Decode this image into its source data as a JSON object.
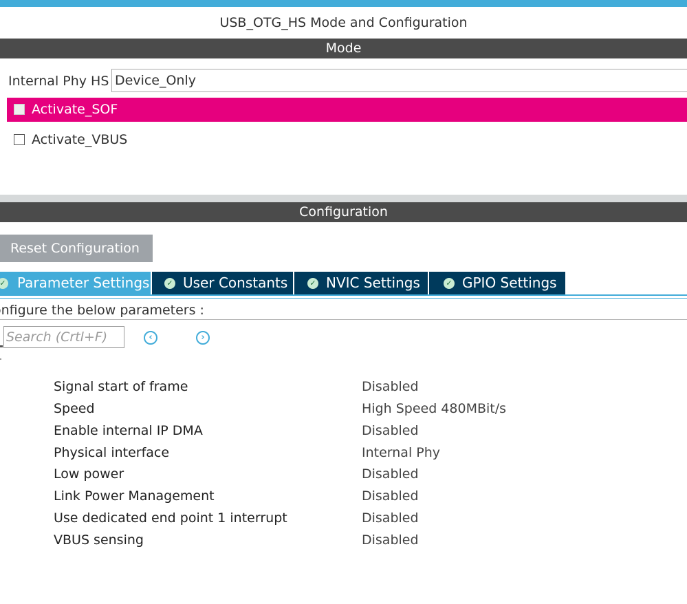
{
  "window": {
    "title": "USB_OTG_HS Mode and Configuration"
  },
  "mode": {
    "header": "Mode",
    "phy": {
      "label": "Internal Phy HS",
      "value": "Device_Only"
    },
    "checkboxes": [
      {
        "label": "Activate_SOF",
        "checked": false,
        "selected": true
      },
      {
        "label": "Activate_VBUS",
        "checked": false,
        "selected": false
      }
    ]
  },
  "configuration": {
    "header": "Configuration",
    "reset_label": "Reset Configuration",
    "tabs": [
      {
        "label": "Parameter Settings",
        "active": true,
        "icon": "check-circle-icon"
      },
      {
        "label": "User Constants",
        "active": false,
        "icon": "check-circle-icon"
      },
      {
        "label": "NVIC Settings",
        "active": false,
        "icon": "check-circle-icon"
      },
      {
        "label": "GPIO Settings",
        "active": false,
        "icon": "check-circle-icon"
      }
    ],
    "configure_text": "onfigure the below parameters :",
    "search": {
      "placeholder": "Search (Crtl+F)",
      "value": ""
    },
    "nav": {
      "prev_icon": "circle-chevron-left-icon",
      "next_icon": "circle-chevron-right-icon"
    },
    "params": [
      {
        "name": "Signal start of frame",
        "value": "Disabled"
      },
      {
        "name": "Speed",
        "value": "High Speed 480MBit/s"
      },
      {
        "name": "Enable internal IP DMA",
        "value": "Disabled"
      },
      {
        "name": "Physical interface",
        "value": "Internal Phy"
      },
      {
        "name": "Low power",
        "value": "Disabled"
      },
      {
        "name": "Link Power Management",
        "value": "Disabled"
      },
      {
        "name": "Use dedicated end point 1 interrupt",
        "value": "Disabled"
      },
      {
        "name": "VBUS sensing",
        "value": "Disabled"
      }
    ]
  },
  "colors": {
    "accent": "#42acd9",
    "header_bg": "#4b4b4b",
    "selected_row": "#e6007e",
    "tab_bg": "#003a5c",
    "button_bg": "#9ea3a8"
  }
}
